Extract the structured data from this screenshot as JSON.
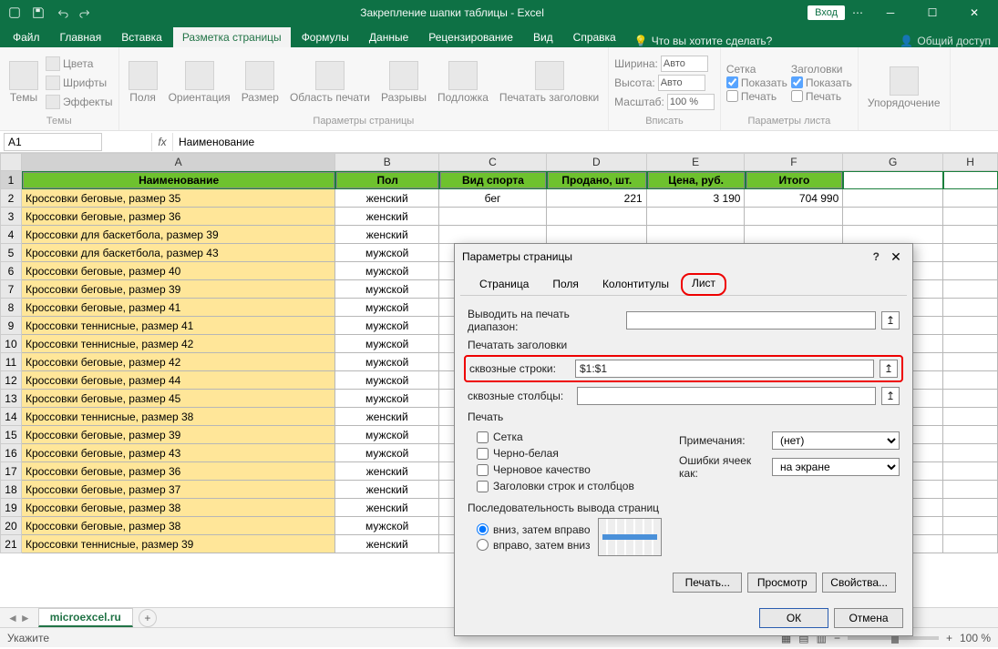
{
  "titlebar": {
    "title": "Закрепление шапки таблицы  -  Excel",
    "login": "Вход"
  },
  "ribbon_tabs": [
    "Файл",
    "Главная",
    "Вставка",
    "Разметка страницы",
    "Формулы",
    "Данные",
    "Рецензирование",
    "Вид",
    "Справка"
  ],
  "active_tab_index": 3,
  "tell_me": "Что вы хотите сделать?",
  "share": "Общий доступ",
  "ribbon": {
    "themes": {
      "label": "Темы",
      "colors": "Цвета",
      "fonts": "Шрифты",
      "effects": "Эффекты",
      "name": "Темы"
    },
    "pagesetup": {
      "margins": "Поля",
      "orientation": "Ориентация",
      "size": "Размер",
      "printarea": "Область печати",
      "breaks": "Разрывы",
      "background": "Подложка",
      "printtitles": "Печатать заголовки",
      "name": "Параметры страницы"
    },
    "fit": {
      "width": "Ширина:",
      "height": "Высота:",
      "scale": "Масштаб:",
      "auto": "Авто",
      "scaleval": "100 %",
      "name": "Вписать"
    },
    "sheetopts": {
      "grid": "Сетка",
      "headings": "Заголовки",
      "show": "Показать",
      "print": "Печать",
      "name": "Параметры листа"
    },
    "arrange": {
      "btn": "Упорядочение",
      "name": ""
    }
  },
  "namebox": "A1",
  "formula": "Наименование",
  "columns": [
    "A",
    "B",
    "C",
    "D",
    "E",
    "F",
    "G",
    "H"
  ],
  "headers": [
    "Наименование",
    "Пол",
    "Вид спорта",
    "Продано, шт.",
    "Цена, руб.",
    "Итого"
  ],
  "rows": [
    [
      "Кроссовки беговые, размер 35",
      "женский",
      "бег",
      "221",
      "3 190",
      "704 990"
    ],
    [
      "Кроссовки беговые, размер 36",
      "женский",
      "",
      "",
      "",
      ""
    ],
    [
      "Кроссовки для баскетбола, размер 39",
      "женский",
      "",
      "",
      "",
      ""
    ],
    [
      "Кроссовки для баскетбола, размер 43",
      "мужской",
      "",
      "",
      "",
      ""
    ],
    [
      "Кроссовки беговые, размер 40",
      "мужской",
      "",
      "",
      "",
      ""
    ],
    [
      "Кроссовки беговые, размер 39",
      "мужской",
      "",
      "",
      "",
      ""
    ],
    [
      "Кроссовки беговые, размер 41",
      "мужской",
      "",
      "",
      "",
      ""
    ],
    [
      "Кроссовки теннисные, размер 41",
      "мужской",
      "",
      "",
      "",
      ""
    ],
    [
      "Кроссовки теннисные, размер 42",
      "мужской",
      "",
      "",
      "",
      ""
    ],
    [
      "Кроссовки беговые, размер 42",
      "мужской",
      "",
      "",
      "",
      ""
    ],
    [
      "Кроссовки беговые, размер 44",
      "мужской",
      "",
      "",
      "",
      ""
    ],
    [
      "Кроссовки беговые, размер 45",
      "мужской",
      "",
      "",
      "",
      ""
    ],
    [
      "Кроссовки теннисные, размер 38",
      "женский",
      "",
      "",
      "",
      ""
    ],
    [
      "Кроссовки беговые, размер 39",
      "мужской",
      "",
      "",
      "",
      ""
    ],
    [
      "Кроссовки беговые, размер 43",
      "мужской",
      "",
      "",
      "",
      ""
    ],
    [
      "Кроссовки беговые, размер 36",
      "женский",
      "",
      "",
      "",
      ""
    ],
    [
      "Кроссовки беговые, размер 37",
      "женский",
      "",
      "",
      "",
      ""
    ],
    [
      "Кроссовки беговые, размер 38",
      "женский",
      "",
      "",
      "",
      ""
    ],
    [
      "Кроссовки беговые, размер 38",
      "мужской",
      "",
      "",
      "",
      ""
    ],
    [
      "Кроссовки теннисные, размер 39",
      "женский",
      "",
      "",
      "",
      ""
    ]
  ],
  "sheet": {
    "name": "microexcel.ru"
  },
  "status": {
    "text": "Укажите",
    "zoom": "100 %"
  },
  "dialog": {
    "title": "Параметры страницы",
    "tabs": [
      "Страница",
      "Поля",
      "Колонтитулы",
      "Лист"
    ],
    "active_tab": 3,
    "print_range_label": "Выводить на печать диапазон:",
    "print_titles": "Печатать заголовки",
    "rows_repeat": "сквозные строки:",
    "rows_value": "$1:$1",
    "cols_repeat": "сквозные столбцы:",
    "print_section": "Печать",
    "grid": "Сетка",
    "bw": "Черно-белая",
    "draft": "Черновое качество",
    "rowcol": "Заголовки строк и столбцов",
    "comments": "Примечания:",
    "comments_val": "(нет)",
    "errors": "Ошибки ячеек как:",
    "errors_val": "на экране",
    "order": "Последовательность вывода страниц",
    "order_down": "вниз, затем вправо",
    "order_over": "вправо, затем вниз",
    "btn_print": "Печать...",
    "btn_preview": "Просмотр",
    "btn_props": "Свойства...",
    "ok": "ОК",
    "cancel": "Отмена"
  }
}
